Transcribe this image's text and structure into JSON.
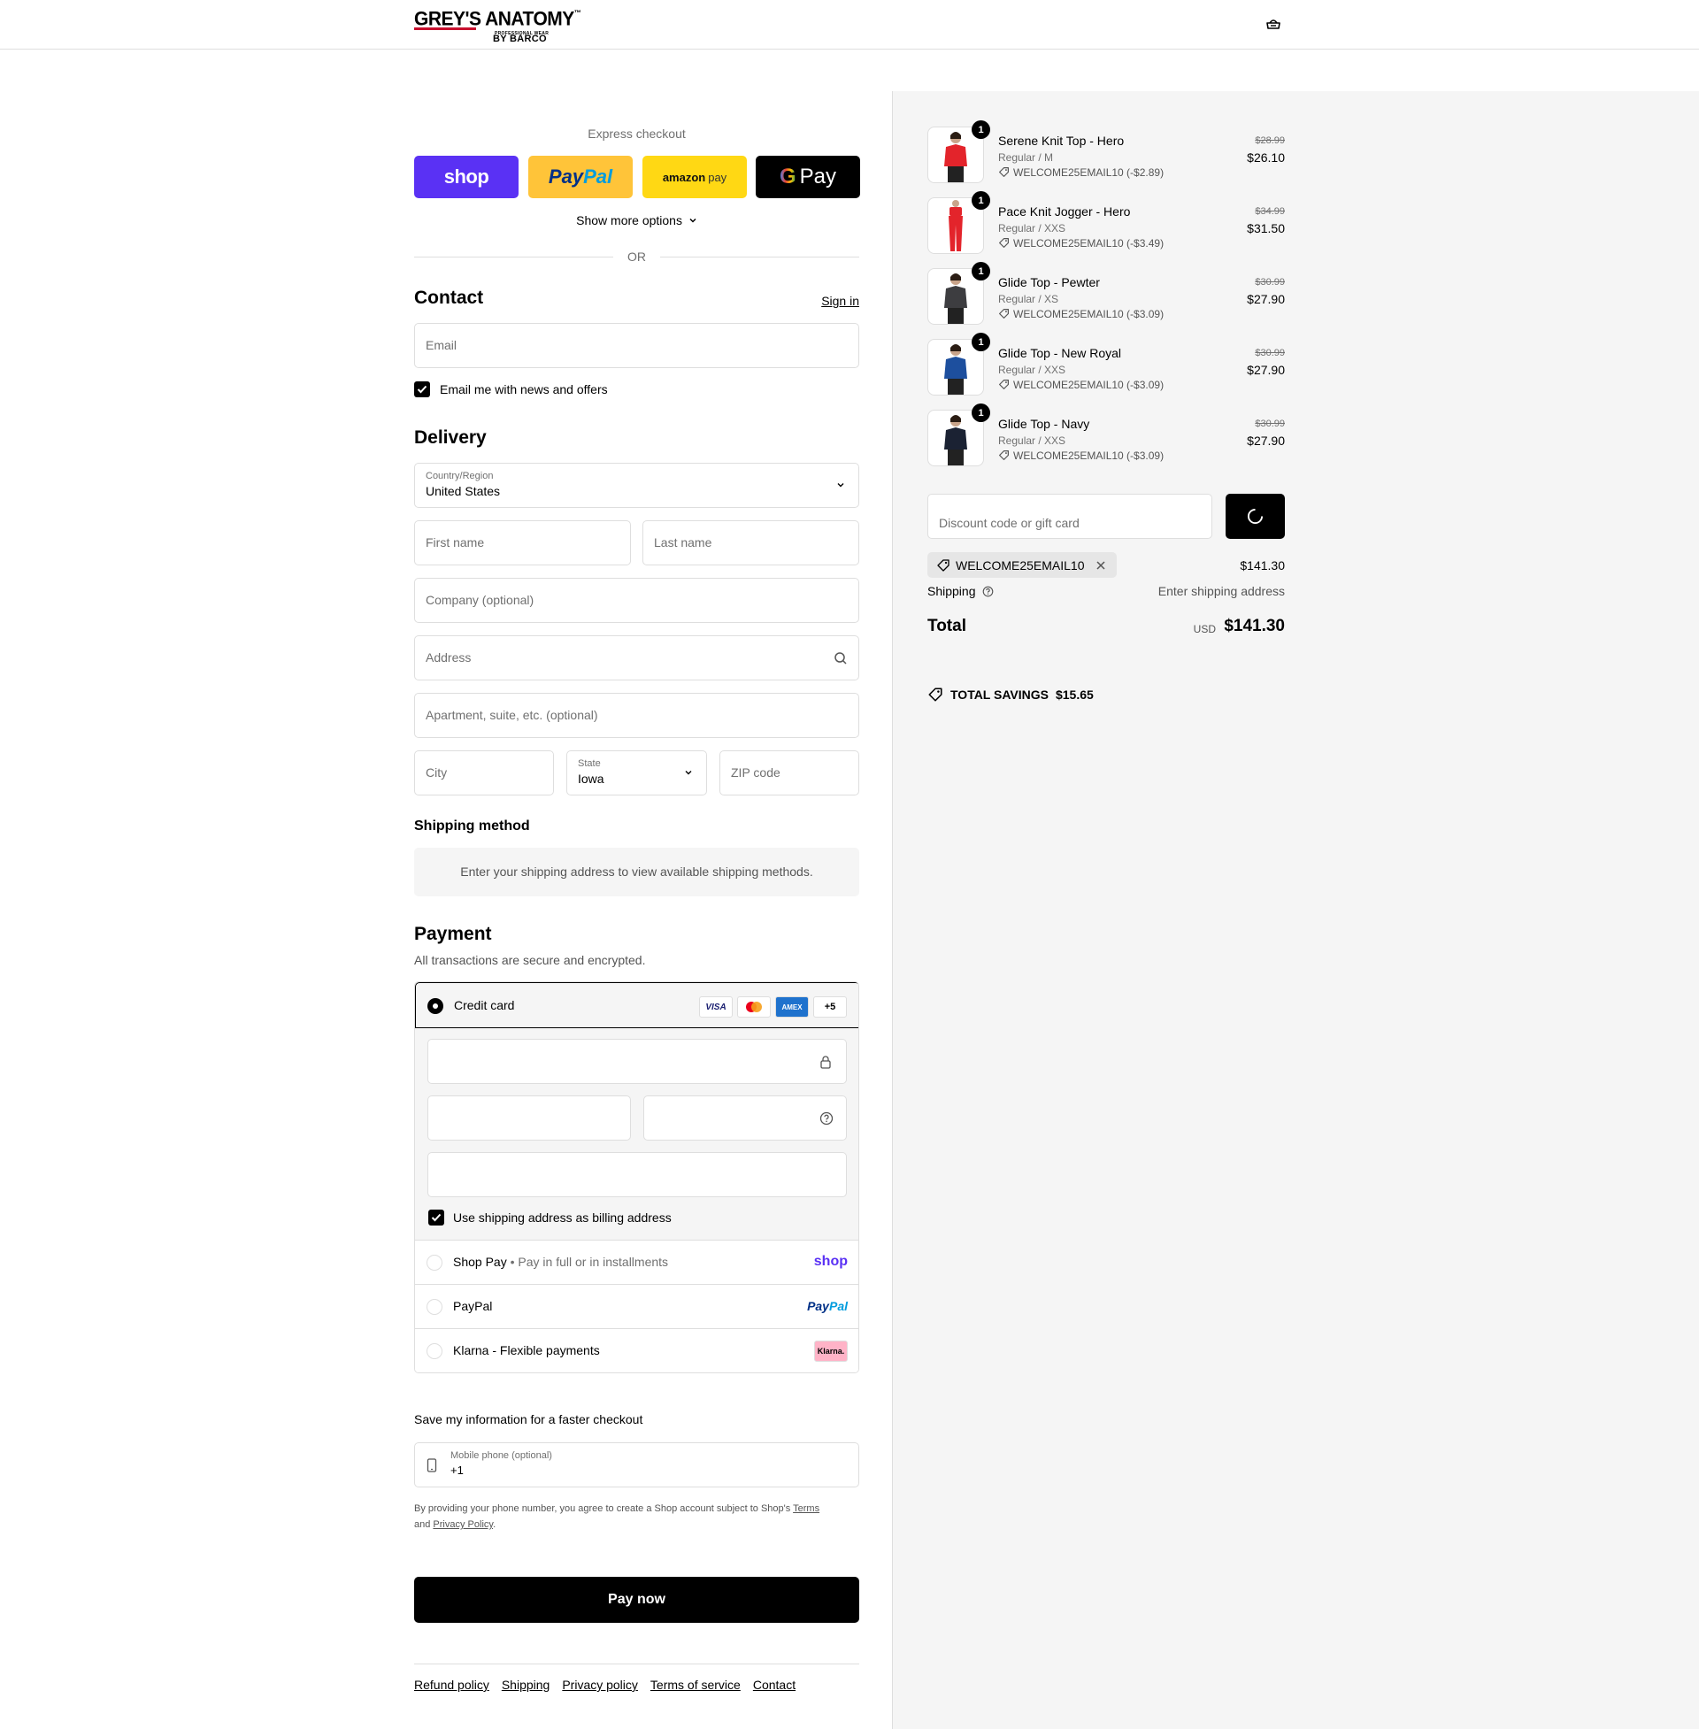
{
  "header": {
    "logo_main": "GREY'S ANATOMY",
    "logo_tm": "™",
    "logo_tagline": "PROFESSIONAL WEAR",
    "logo_by": "BY BARCO"
  },
  "express": {
    "label": "Express checkout",
    "shop": "shop",
    "paypal_a": "Pay",
    "paypal_b": "Pal",
    "amazon_a": "amazon",
    "amazon_b": "pay",
    "gpay_g": "G",
    "gpay_text": "Pay",
    "more_options": "Show more options",
    "or": "OR"
  },
  "contact": {
    "title": "Contact",
    "signin": "Sign in",
    "email_placeholder": "Email",
    "news_label": "Email me with news and offers"
  },
  "delivery": {
    "title": "Delivery",
    "country_label": "Country/Region",
    "country_value": "United States",
    "first_name": "First name",
    "last_name": "Last name",
    "company": "Company (optional)",
    "address": "Address",
    "apartment": "Apartment, suite, etc. (optional)",
    "city": "City",
    "state_label": "State",
    "state_value": "Iowa",
    "zip": "ZIP code"
  },
  "shipping_method": {
    "title": "Shipping method",
    "notice": "Enter your shipping address to view available shipping methods."
  },
  "payment": {
    "title": "Payment",
    "subtitle": "All transactions are secure and encrypted.",
    "credit_card": "Credit card",
    "card_logos": [
      "VISA",
      "MC",
      "AMEX",
      "+5"
    ],
    "billing_same": "Use shipping address as billing address",
    "shop_pay": "Shop Pay",
    "shop_pay_sub": "Pay in full or in installments",
    "shop_pay_logo": "shop",
    "paypal": "PayPal",
    "paypal_logo_a": "Pay",
    "paypal_logo_b": "Pal",
    "klarna": "Klarna - Flexible payments",
    "klarna_logo": "Klarna."
  },
  "save_info": {
    "title": "Save my information for a faster checkout",
    "phone_label": "Mobile phone (optional)",
    "phone_value": "+1",
    "legal_a": "By providing your phone number, you agree to create a Shop account subject to Shop's ",
    "legal_terms": "Terms",
    "legal_and": "and ",
    "legal_privacy": "Privacy Policy",
    "legal_end": "."
  },
  "pay_now": "Pay now",
  "footer": [
    "Refund policy",
    "Shipping",
    "Privacy policy",
    "Terms of service",
    "Contact"
  ],
  "cart": {
    "items": [
      {
        "name": "Serene Knit Top - Hero",
        "variant": "Regular / M",
        "discount": "WELCOME25EMAIL10 (-$2.89)",
        "old_price": "$28.99",
        "price": "$26.10",
        "qty": "1",
        "color": "#e3242b"
      },
      {
        "name": "Pace Knit Jogger - Hero",
        "variant": "Regular / XXS",
        "discount": "WELCOME25EMAIL10 (-$3.49)",
        "old_price": "$34.99",
        "price": "$31.50",
        "qty": "1",
        "color": "#e3242b"
      },
      {
        "name": "Glide Top - Pewter",
        "variant": "Regular / XS",
        "discount": "WELCOME25EMAIL10 (-$3.09)",
        "old_price": "$30.99",
        "price": "$27.90",
        "qty": "1",
        "color": "#3d3d40"
      },
      {
        "name": "Glide Top - New Royal",
        "variant": "Regular / XXS",
        "discount": "WELCOME25EMAIL10 (-$3.09)",
        "old_price": "$30.99",
        "price": "$27.90",
        "qty": "1",
        "color": "#1d4f9e"
      },
      {
        "name": "Glide Top - Navy",
        "variant": "Regular / XXS",
        "discount": "WELCOME25EMAIL10 (-$3.09)",
        "old_price": "$30.99",
        "price": "$27.90",
        "qty": "1",
        "color": "#1b2233"
      }
    ],
    "discount_placeholder": "Discount code or gift card",
    "applied_code": "WELCOME25EMAIL10",
    "subtotal": "$141.30",
    "shipping_label": "Shipping",
    "shipping_value": "Enter shipping address",
    "total_label": "Total",
    "currency": "USD",
    "total": "$141.30",
    "savings_label": "TOTAL SAVINGS",
    "savings_value": "$15.65"
  }
}
